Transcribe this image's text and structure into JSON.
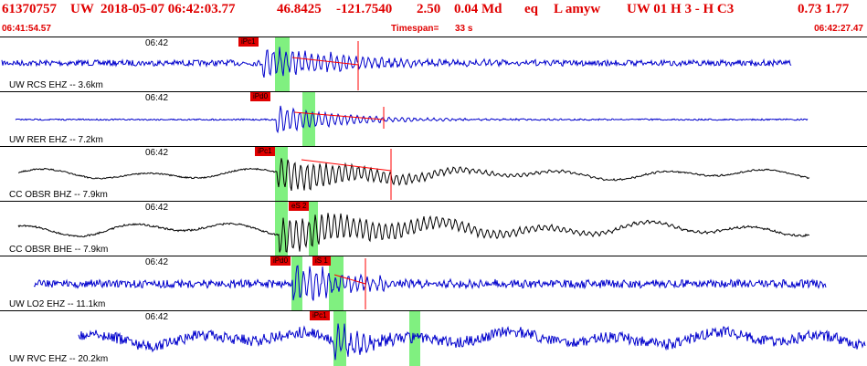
{
  "header": {
    "event_id": "61370757",
    "network": "UW",
    "origin_time": "2018-05-07 06:42:03.77",
    "latitude": "46.8425",
    "longitude": "-121.7540",
    "depth": "2.50",
    "magnitude": "0.04 Md",
    "event_type": "eq",
    "flags": "L amyw",
    "solution": "UW 01  H  3  -  H C3",
    "values": "0.73  1.77",
    "start_time": "06:41:54.57",
    "timespan_label": "Timespan=",
    "timespan_value": "33 s",
    "end_time": "06:42:27.47"
  },
  "colors": {
    "header_text": "#e00000",
    "trace_blue": "#0000cc",
    "trace_black": "#000000",
    "pick_box": "#e00000",
    "phase_window": "#80f080",
    "coda_line": "#ff0000"
  },
  "traces": [
    {
      "station": "UW RCS EHZ -- 3.6km",
      "time_label": "06:42",
      "color": "blue",
      "picks": [
        "iPc1"
      ]
    },
    {
      "station": "UW RER EHZ -- 7.2km",
      "time_label": "06:42",
      "color": "blue",
      "picks": [
        "iPd0"
      ]
    },
    {
      "station": "CC OBSR BHZ -- 7.9km",
      "time_label": "06:42",
      "color": "black",
      "picks": [
        "iPc1"
      ]
    },
    {
      "station": "CC OBSR BHE -- 7.9km",
      "time_label": "06:42",
      "color": "black",
      "picks": [
        "eS 2"
      ]
    },
    {
      "station": "UW LO2 EHZ -- 11.1km",
      "time_label": "06:42",
      "color": "blue",
      "picks": [
        "iPd0",
        "iS 1"
      ]
    },
    {
      "station": "UW RVC EHZ -- 20.2km",
      "time_label": "06:42",
      "color": "blue",
      "picks": [
        "iPc1"
      ]
    }
  ]
}
